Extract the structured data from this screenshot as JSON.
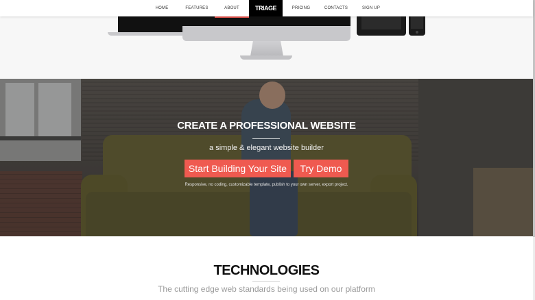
{
  "nav": {
    "items": [
      "HOME",
      "FEATURES",
      "ABOUT",
      "PRICING",
      "CONTACTS",
      "SIGN UP"
    ],
    "brand": "TRIAGE"
  },
  "hero": {
    "title": "CREATE A PROFESSIONAL WEBSITE",
    "subtitle": "a simple & elegant website builder",
    "primary_button": "Start Building Your Site",
    "secondary_button": "Try Demo",
    "note": "Responsive, no coding, customizable template, publish to your own server, export project."
  },
  "tech": {
    "title": "TECHNOLOGIES",
    "subtitle": "The cutting edge web standards being used on our platform"
  },
  "colors": {
    "accent": "#ef5a50",
    "brand_bg": "#000000",
    "nav_bg": "#ffffff"
  }
}
